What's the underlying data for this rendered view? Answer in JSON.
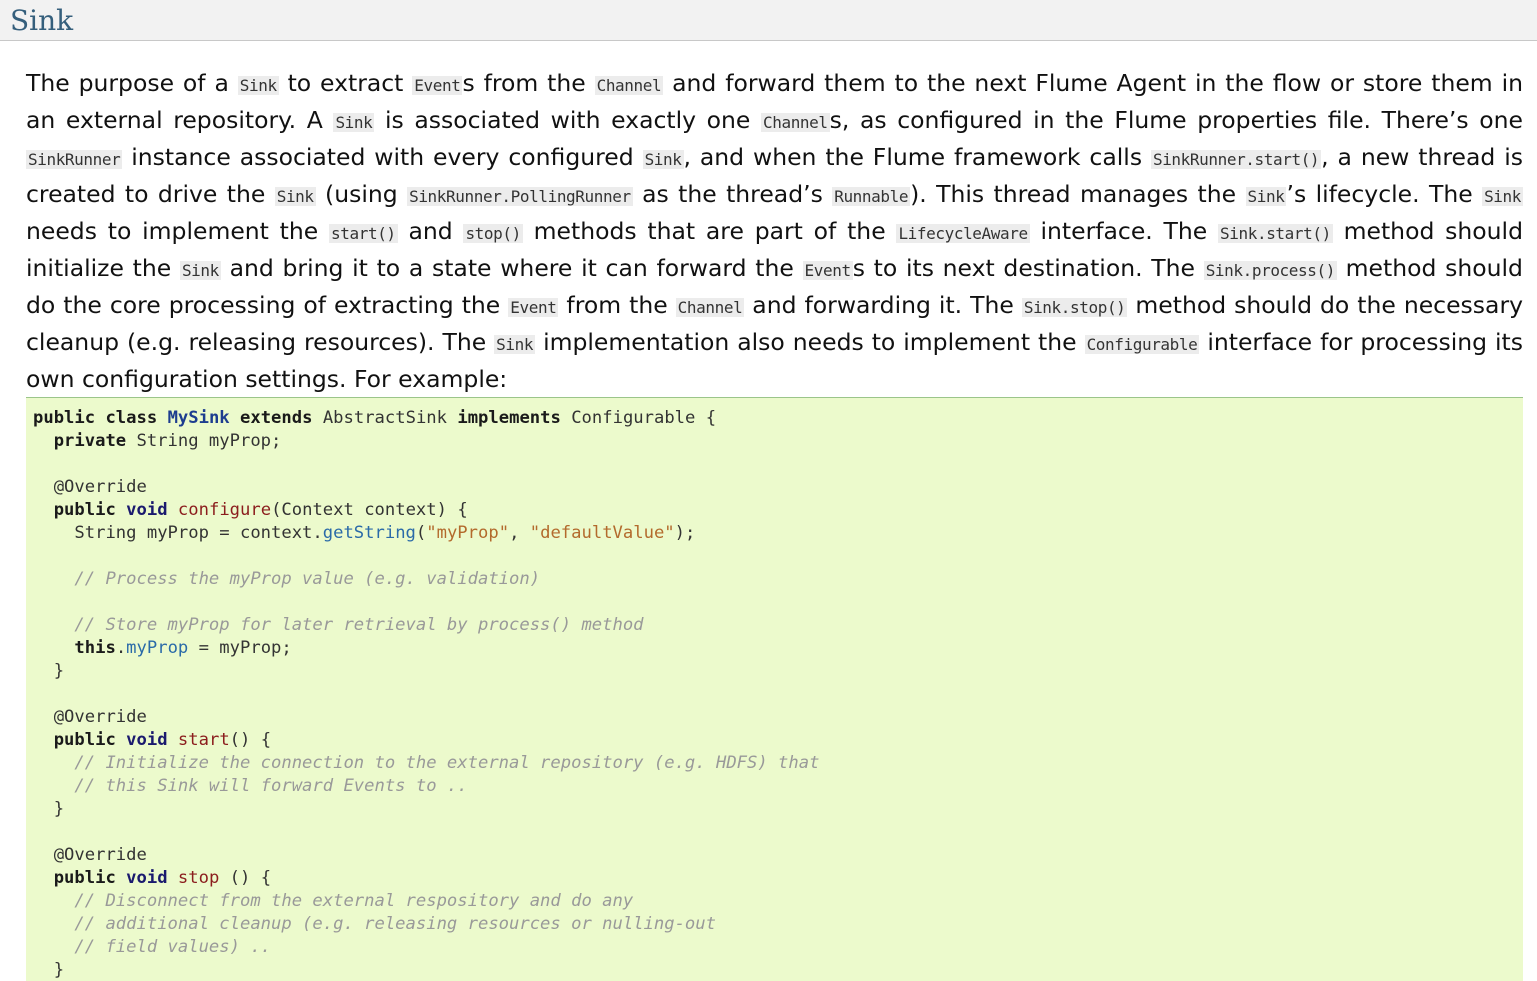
{
  "section": {
    "title": "Sink"
  },
  "paragraph": {
    "t1": "The purpose of a ",
    "c1": "Sink",
    "t2": " to extract ",
    "c2": "Event",
    "t3": "s from the ",
    "c3": "Channel",
    "t4": " and forward them to the next Flume Agent in the flow or store them in an external repository. A ",
    "c4": "Sink",
    "t5": " is associated with exactly one ",
    "c5": "Channel",
    "t6": "s, as configured in the Flume properties file. There’s one ",
    "c6": "SinkRunner",
    "t7": " instance associated with every configured ",
    "c7": "Sink",
    "t8": ", and when the Flume framework calls ",
    "c8": "SinkRunner.start()",
    "t9": ", a new thread is created to drive the ",
    "c9": "Sink",
    "t10": " (using ",
    "c10": "SinkRunner.PollingRunner",
    "t11": " as the thread’s ",
    "c11": "Runnable",
    "t12": "). This thread manages the ",
    "c12": "Sink",
    "t13": "’s lifecycle. The ",
    "c13": "Sink",
    "t14": " needs to implement the ",
    "c14": "start()",
    "t15": " and ",
    "c15": "stop()",
    "t16": " methods that are part of the ",
    "c16": "LifecycleAware",
    "t17": " interface. The ",
    "c17": "Sink.start()",
    "t18": " method should initialize the ",
    "c18": "Sink",
    "t19": " and bring it to a state where it can forward the ",
    "c19": "Event",
    "t20": "s to its next destination. The ",
    "c20": "Sink.process()",
    "t21": " method should do the core processing of extracting the ",
    "c21": "Event",
    "t22": " from the ",
    "c22": "Channel",
    "t23": " and forwarding it. The ",
    "c23": "Sink.stop()",
    "t24": " method should do the necessary cleanup (e.g. releasing resources). The ",
    "c24": "Sink",
    "t25": " implementation also needs to implement the ",
    "c25": "Configurable",
    "t26": " interface for processing its own configuration settings. For example:"
  },
  "code": {
    "l1_public": "public",
    "l1_class": "class",
    "l1_name": "MySink",
    "l1_extends": "extends",
    "l1_super": "AbstractSink",
    "l1_implements": "implements",
    "l1_iface": "Configurable {",
    "l2_private": "private",
    "l2_rest": " String myProp;",
    "l4": "@Override",
    "l5_public": "public",
    "l5_void": "void",
    "l5_fn": "configure",
    "l5_rest": "(Context context) {",
    "l6_a": "String myProp = context.",
    "l6_m": "getString",
    "l6_p1": "(",
    "l6_s1": "\"myProp\"",
    "l6_comma": ", ",
    "l6_s2": "\"defaultValue\"",
    "l6_end": ");",
    "l8": "// Process the myProp value (e.g. validation)",
    "l10": "// Store myProp for later retrieval by process() method",
    "l11_this": "this",
    "l11_dot": ".",
    "l11_m": "myProp",
    "l11_rest": " = myProp;",
    "l12": "}",
    "l14": "@Override",
    "l15_public": "public",
    "l15_void": "void",
    "l15_fn": "start",
    "l15_rest": "() {",
    "l16": "// Initialize the connection to the external repository (e.g. HDFS) that",
    "l17": "// this Sink will forward Events to ..",
    "l18": "}",
    "l20": "@Override",
    "l21_public": "public",
    "l21_void": "void",
    "l21_fn": "stop",
    "l21_rest": " () {",
    "l22": "// Disconnect from the external respository and do any",
    "l23": "// additional cleanup (e.g. releasing resources or nulling-out",
    "l24": "// field values) ..",
    "l25": "}"
  }
}
